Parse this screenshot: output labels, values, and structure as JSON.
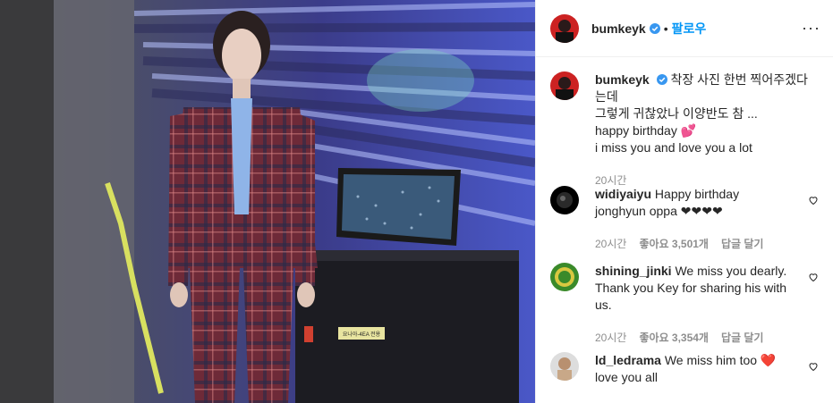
{
  "post": {
    "username": "bumkeyk",
    "follow_label": "팔로우",
    "more_label": "···",
    "caption_lines": [
      "착장 사진 한번 찍어주겠다는데",
      "그렇게 귀찮았나 이양반도 참 ...",
      "happy birthday 💕",
      "i miss you and love you a lot"
    ],
    "caption_time": "20시간"
  },
  "comments": [
    {
      "username": "widiyaiyu",
      "text_line1": "Happy birthday",
      "text_line2": "jonghyun oppa ❤❤❤❤",
      "time": "20시간",
      "likes": "좋아요 3,501개",
      "reply": "답글 달기"
    },
    {
      "username": "shining_jinki",
      "text_line1": "We miss you dearly.",
      "text_line2": "Thank you Key for sharing his with",
      "text_line3": "us.",
      "time": "20시간",
      "likes": "좋아요 3,354개",
      "reply": "답글 달기"
    },
    {
      "username": "ld_ledrama",
      "text_line1": "We miss him too ❤️",
      "text_line2": "love you all"
    }
  ],
  "photo": {
    "case_label": "요나아-4EA 전용"
  },
  "colors": {
    "accent": "#0095f6",
    "verified": "#3897f0",
    "muted": "#8e8e8e"
  },
  "icons": [
    "verified-badge-icon",
    "more-options-icon",
    "heart-icon"
  ]
}
